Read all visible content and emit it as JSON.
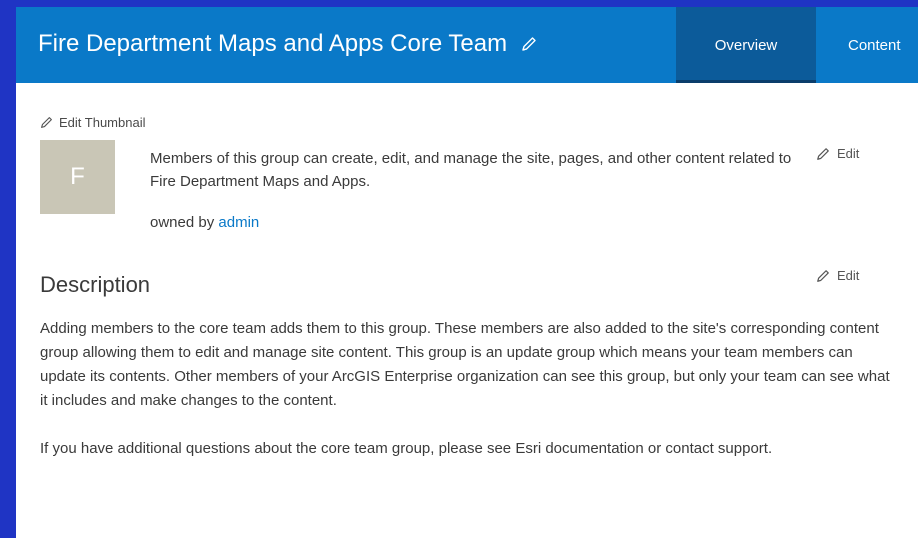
{
  "header": {
    "title": "Fire Department Maps and Apps Core Team",
    "tabs": [
      {
        "label": "Overview",
        "active": true
      },
      {
        "label": "Content",
        "active": false
      }
    ]
  },
  "thumbnail": {
    "edit_label": "Edit Thumbnail",
    "letter": "F"
  },
  "summary": {
    "text": "Members of this group can create, edit, and manage the site, pages, and other content related to Fire Department Maps and Apps.",
    "edit_label": "Edit",
    "owned_by_prefix": "owned by",
    "owner": "admin"
  },
  "description": {
    "heading": "Description",
    "edit_label": "Edit",
    "paragraphs": [
      "Adding members to the core team adds them to this group. These members are also added to the site's corresponding content group allowing them to edit and manage site content. This group is an update group which means your team members can update its contents. Other members of your ArcGIS Enterprise organization can see this group, but only your team can see what it includes and make changes to the content.",
      "If you have additional questions about the core team group, please see Esri documentation or contact support."
    ]
  },
  "colors": {
    "background": "#1f34c4",
    "header": "#0a79c8",
    "active_tab": "#0c5b9a",
    "link": "#0a79c8",
    "thumbnail": "#c9c6b6"
  },
  "icons": [
    "pencil-icon"
  ]
}
